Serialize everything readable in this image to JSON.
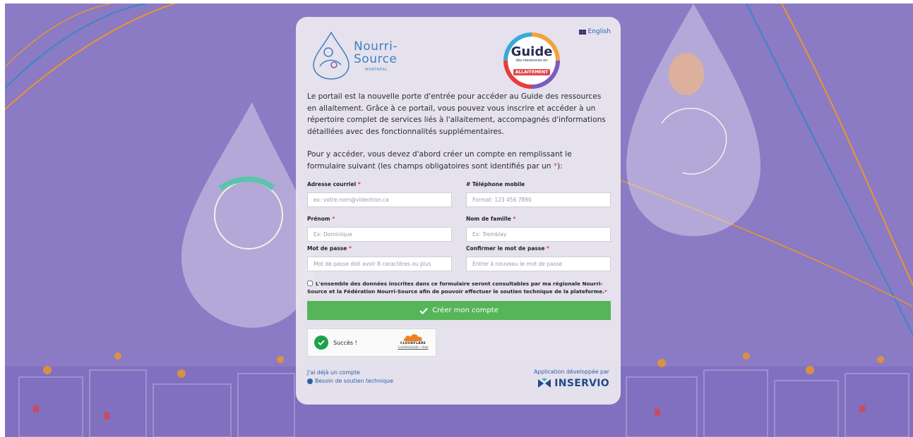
{
  "header": {
    "lang_link": "English",
    "logo_nourri_line1": "Nourri-",
    "logo_nourri_line2": "Source",
    "logo_nourri_city": "MONTRÉAL",
    "logo_guide_title": "Guide",
    "logo_guide_sub": "des ressources en",
    "logo_guide_tag": "ALLAITEMENT"
  },
  "intro": {
    "paragraph1": "Le portail est la nouvelle porte d'entrée pour accéder au Guide des ressources en allaitement. Grâce à ce portail, vous pouvez vous inscrire et accéder à un répertoire complet de services liés à l'allaitement, accompagnés d'informations détaillées avec des fonctionnalités supplémentaires.",
    "paragraph2_a": "Pour y accéder, vous devez d'abord créer un compte en remplissant le formulaire suivant (les champs obligatoires sont identifiés par un ",
    "paragraph2_star": "*",
    "paragraph2_b": "):"
  },
  "form": {
    "email": {
      "label": "Adresse courriel",
      "placeholder": "ex: votre.nom@videotron.ca",
      "value": ""
    },
    "phone": {
      "label": "# Téléphone mobile",
      "placeholder": "Format: 123 456 7890",
      "value": ""
    },
    "firstname": {
      "label": "Prénom",
      "placeholder": "Ex: Dominique",
      "value": ""
    },
    "lastname": {
      "label": "Nom de famille",
      "placeholder": "Ex: Tremblay",
      "value": ""
    },
    "password": {
      "label": "Mot de passe",
      "placeholder": "Mot de passe doit avoir 8 caractères ou plus",
      "value": ""
    },
    "password_confirm": {
      "label": "Confirmer le mot de passe",
      "placeholder": "Entrer à nouveau le mot de passe",
      "value": ""
    },
    "required_marker": "*",
    "consent_text": "L'ensemble des données inscrites dans ce formulaire seront consultables par ma régionale Nourri-Source et la Fédération Nourri-Source afin de pouvoir effectuer le soutien technique de la plateforme.",
    "consent_checked": false,
    "submit_label": "Créer mon compte"
  },
  "captcha": {
    "status": "Succès !",
    "brand": "CLOUDFLARE",
    "links": "Confidentialité • Aide"
  },
  "footer": {
    "login_link": "J'ai déjà un compte",
    "support_link": "Besoin de soutien technique",
    "developed_by": "Application développée par",
    "developer_name": "INSERVIO"
  },
  "colors": {
    "background": "#8b7ac4",
    "button": "#55b558",
    "link": "#2d5ea8",
    "required": "#e03b3b"
  }
}
